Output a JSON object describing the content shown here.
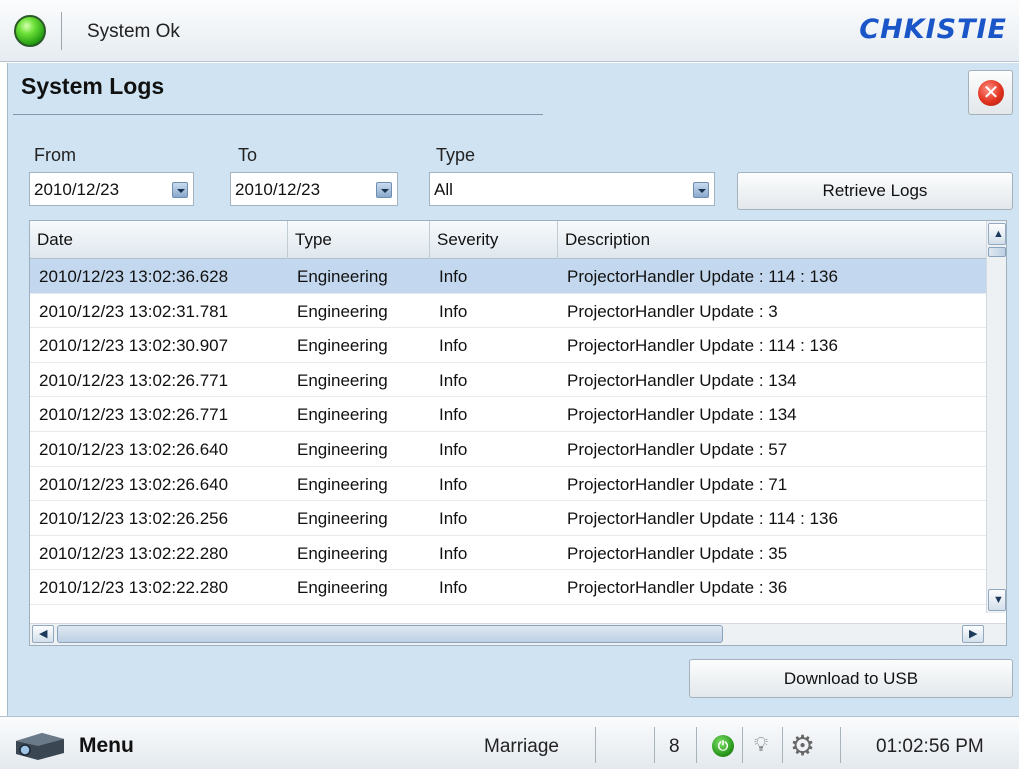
{
  "status": {
    "text": "System Ok",
    "color": "#2fb31f"
  },
  "brand": {
    "name": "CHKISTIE"
  },
  "page": {
    "title": "System Logs"
  },
  "filters": {
    "from_label": "From",
    "from_value": "2010/12/23",
    "to_label": "To",
    "to_value": "2010/12/23",
    "type_label": "Type",
    "type_value": "All"
  },
  "buttons": {
    "retrieve": "Retrieve Logs",
    "download": "Download to USB"
  },
  "table": {
    "columns": [
      "Date",
      "Type",
      "Severity",
      "Description"
    ],
    "rows": [
      [
        "2010/12/23 13:02:36.628",
        "Engineering",
        "Info",
        "ProjectorHandler Update : 114 : 136"
      ],
      [
        "2010/12/23 13:02:31.781",
        "Engineering",
        "Info",
        "ProjectorHandler Update : 3"
      ],
      [
        "2010/12/23 13:02:30.907",
        "Engineering",
        "Info",
        "ProjectorHandler Update : 114 : 136"
      ],
      [
        "2010/12/23 13:02:26.771",
        "Engineering",
        "Info",
        "ProjectorHandler Update : 134"
      ],
      [
        "2010/12/23 13:02:26.771",
        "Engineering",
        "Info",
        "ProjectorHandler Update : 134"
      ],
      [
        "2010/12/23 13:02:26.640",
        "Engineering",
        "Info",
        "ProjectorHandler Update : 57"
      ],
      [
        "2010/12/23 13:02:26.640",
        "Engineering",
        "Info",
        "ProjectorHandler Update : 71"
      ],
      [
        "2010/12/23 13:02:26.256",
        "Engineering",
        "Info",
        "ProjectorHandler Update : 114 : 136"
      ],
      [
        "2010/12/23 13:02:22.280",
        "Engineering",
        "Info",
        "ProjectorHandler Update : 35"
      ],
      [
        "2010/12/23 13:02:22.280",
        "Engineering",
        "Info",
        "ProjectorHandler Update : 36"
      ]
    ],
    "selected_row": 0
  },
  "taskbar": {
    "menu_label": "Menu",
    "content_name": "Marriage",
    "count": "8",
    "time": "01:02:56 PM",
    "icons": [
      "projector-icon",
      "power-icon",
      "lightbulb-icon",
      "projector-settings-icon"
    ]
  }
}
